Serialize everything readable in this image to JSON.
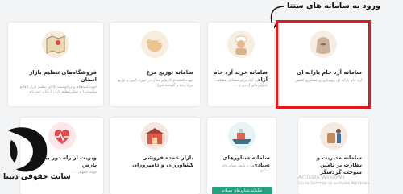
{
  "annotation": {
    "text": "ورود به سامانه های ستتا"
  },
  "cards_top": [
    {
      "title": "سامانه آرد خام یارانه ای",
      "desc": "آرد خام یارانه ای روستایی و عشایری کشور",
      "icon": "flour-sack-icon"
    },
    {
      "title": "سامانه خرید آرد خام آزاد",
      "desc": "خرید آرد آزاد برای مشاغل مختلف، نانوایی‌های آزادپز و ...",
      "icon": "baker-icon"
    },
    {
      "title": "سامانه توزیع مرغ",
      "desc": "جهت کسب و کارهای فعال در حوزه تامین و توزیع مرغ زنده و گوشت مرغ",
      "icon": "chicken-icon"
    },
    {
      "title": "فروشگاه‌های تنظیم بازار استان",
      "desc": "جهت استعلام و درخواست کالای تنظیم بازار (اقلام مناسبتی) و ستاد تنظیم بازار تا پایان ثبت نام ...",
      "icon": "map-icon"
    }
  ],
  "cards_bottom": [
    {
      "title": "سامانه مدیریت و نظارت بر تامین سوخت گردشگر",
      "desc": "",
      "icon": "tourist-icon"
    },
    {
      "title": "سامانه شناورهای صیادی",
      "desc": "جهت مدیریت و پایش شناورهای صیادی",
      "icon": "ship-icon",
      "badge": "سامانه شناورهای صیادی"
    },
    {
      "title": "بازار عمده فروشی کشاورزان و دامپروران",
      "desc": "",
      "icon": "market-icon"
    },
    {
      "title": "ویزیت از راه دور بیماران پارس",
      "desc": "جهت تسهیل ...",
      "icon": "heart-icon"
    }
  ],
  "watermark": {
    "line1": "Activate Windows",
    "line2": "Go to Settings to activate Windows."
  },
  "logo": {
    "text": "سایت حقوقی دیپنا"
  }
}
